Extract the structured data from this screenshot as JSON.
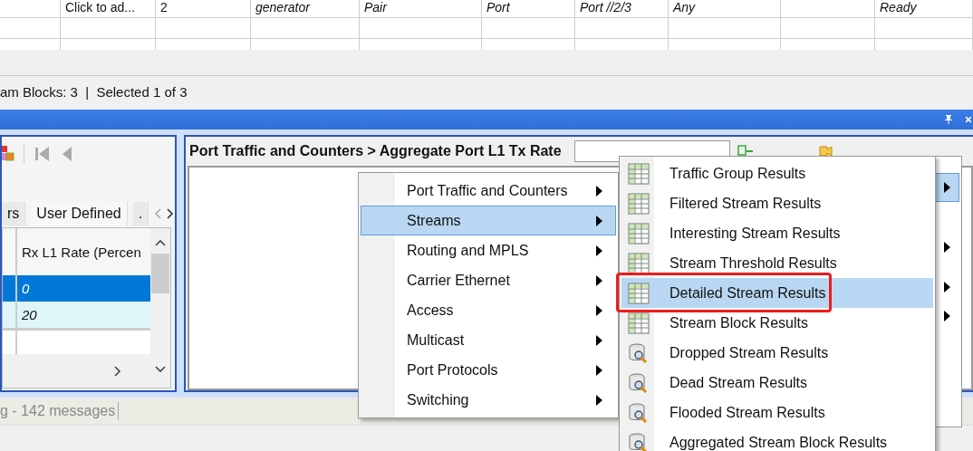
{
  "top_table": {
    "rows": [
      {
        "cells": [
          {
            "text": "Click to ad...",
            "italic": false
          },
          {
            "text": "2",
            "italic": false
          },
          {
            "text": "generator",
            "italic": true
          },
          {
            "text": "Pair",
            "italic": true
          },
          {
            "text": "Port",
            "italic": true
          },
          {
            "text": "Port //2/3",
            "italic": true
          },
          {
            "text": "Any",
            "italic": true
          },
          {},
          {
            "text": "Ready",
            "italic": true
          }
        ]
      }
    ]
  },
  "status_bar": {
    "text": "am Blocks: 3  |  Selected 1 of 3"
  },
  "left_panel": {
    "tabs": [
      {
        "label": "rs",
        "selected": false
      },
      {
        "label": "User Defined",
        "selected": true
      },
      {
        "label": ".",
        "selected": false
      }
    ],
    "grid": {
      "column": "Rx L1 Rate (Percen",
      "rows": [
        {
          "value": "0",
          "selected": true,
          "shaded": false
        },
        {
          "value": "20",
          "selected": false,
          "shaded": true
        }
      ]
    }
  },
  "right_panel": {
    "title": "Port Traffic and Counters > Aggregate Port L1 Tx Rate"
  },
  "message_bar": {
    "text": "g - 142 messages"
  },
  "context_menu": {
    "items": [
      {
        "label": "Port Traffic and Counters",
        "selected": false
      },
      {
        "label": "Streams",
        "selected": true
      },
      {
        "label": "Routing and MPLS",
        "selected": false
      },
      {
        "label": "Carrier Ethernet",
        "selected": false
      },
      {
        "label": "Access",
        "selected": false
      },
      {
        "label": "Multicast",
        "selected": false
      },
      {
        "label": "Port Protocols",
        "selected": false
      },
      {
        "label": "Switching",
        "selected": false
      }
    ]
  },
  "submenu": {
    "items": [
      {
        "label": "Traffic Group Results",
        "selected": false,
        "kind": "grid"
      },
      {
        "label": "Filtered Stream Results",
        "selected": false,
        "kind": "grid"
      },
      {
        "label": "Interesting Stream Results",
        "selected": false,
        "kind": "grid"
      },
      {
        "label": "Stream Threshold Results",
        "selected": false,
        "kind": "grid"
      },
      {
        "label": "Detailed Stream Results",
        "selected": true,
        "kind": "grid"
      },
      {
        "label": "Stream Block Results",
        "selected": false,
        "kind": "grid"
      },
      {
        "label": "Dropped Stream Results",
        "selected": false,
        "kind": "search"
      },
      {
        "label": "Dead Stream Results",
        "selected": false,
        "kind": "search"
      },
      {
        "label": "Flooded Stream Results",
        "selected": false,
        "kind": "search"
      },
      {
        "label": "Aggregated Stream Block Results",
        "selected": false,
        "kind": "search"
      }
    ]
  },
  "back_menu": {
    "items": [
      {
        "selected": true,
        "submenu": true
      },
      {
        "selected": false,
        "submenu": true
      },
      {
        "selected": false,
        "submenu": true
      },
      {
        "selected": false,
        "submenu": true
      }
    ]
  },
  "annotation": {
    "kind": "highlight-box"
  }
}
